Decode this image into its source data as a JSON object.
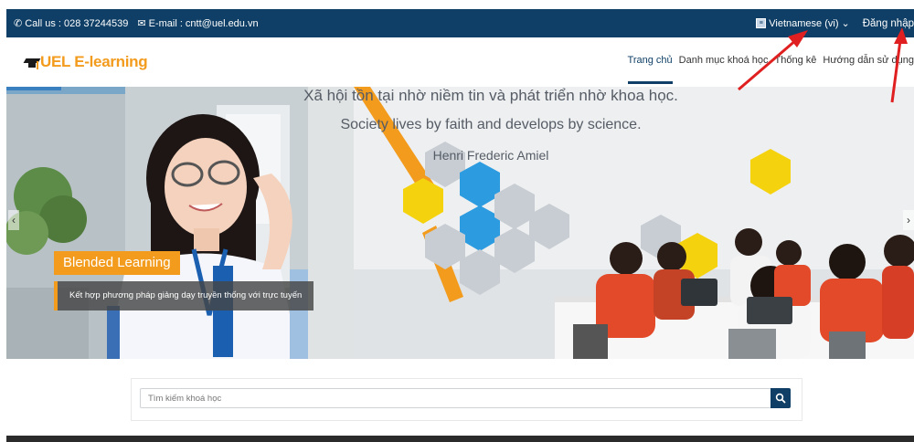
{
  "contact": {
    "phone_label": "Call us : 028 37244539",
    "email_label": "E-mail : cntt@uel.edu.vn"
  },
  "top_right": {
    "language": "Vietnamese (vi)",
    "login": "Đăng nhập"
  },
  "brand": {
    "name": "UEL E-learning"
  },
  "nav": {
    "items": [
      {
        "label": "Trang chủ"
      },
      {
        "label": "Danh mục khoá học"
      },
      {
        "label": "Thống kê"
      },
      {
        "label": "Hướng dẫn sử dụng"
      }
    ]
  },
  "banner": {
    "quote_vi": "Xã hội tồn tại nhờ niềm tin và phát triển nhờ khoa học.",
    "quote_en": "Society lives by faith and develops by science.",
    "quote_author": "Henri Frederic Amiel",
    "caption_title": "Blended Learning",
    "caption_text": "Kết hợp phương pháp giảng dạy truyền thống với trực tuyến"
  },
  "search": {
    "placeholder": "Tìm kiếm khoá học"
  },
  "colors": {
    "brand_navy": "#0f3f66",
    "brand_orange": "#f29b1d",
    "annotation_red": "#e02020"
  }
}
